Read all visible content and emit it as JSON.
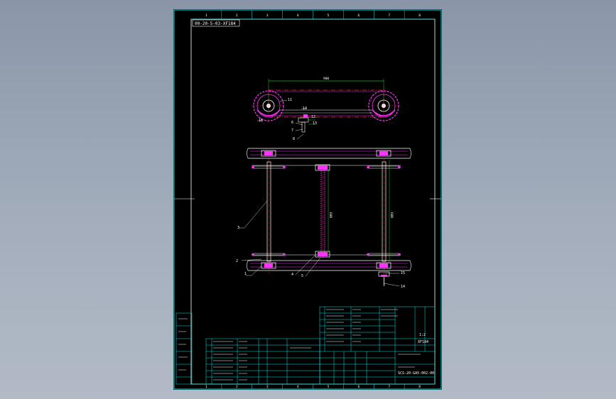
{
  "drawing": {
    "title_tag": "00-20-5-03-XF184",
    "border_numbers": [
      "1",
      "2",
      "3",
      "4",
      "5",
      "6",
      "7",
      "8"
    ],
    "dimension_top": "900",
    "dimension_vertical_1": "600",
    "dimension_vertical_2": "600"
  },
  "callouts": [
    "1",
    "2",
    "3",
    "4",
    "5",
    "6",
    "7",
    "8",
    "11",
    "12",
    "13",
    "14",
    "15",
    "16"
  ],
  "title_block": {
    "drawing_number": "SCS-20-GA5-002-00",
    "name": "XF184",
    "scale": "1:2"
  },
  "colors": {
    "frame": "#00e5e5",
    "part_line": "#ff33ff",
    "center_line": "#ff3333",
    "dimension": "#33ff33",
    "text": "#ffffff"
  }
}
